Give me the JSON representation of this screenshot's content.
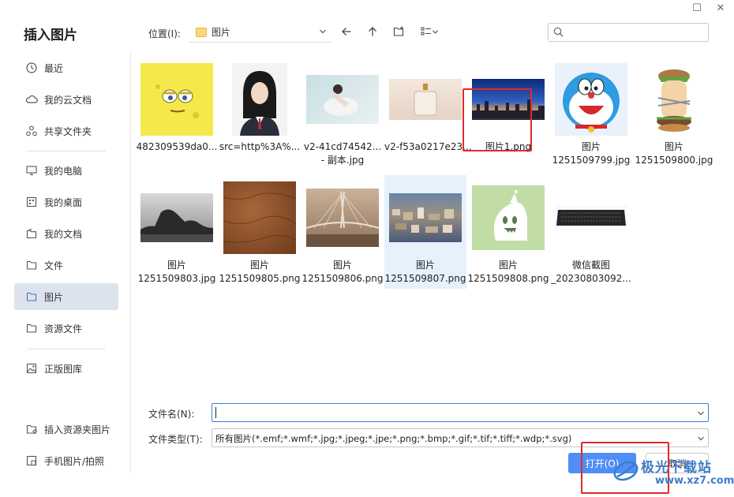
{
  "window": {
    "maximize_glyph": "☐",
    "close_glyph": "✕"
  },
  "title": "插入图片",
  "sidebar": {
    "items": [
      {
        "label": "最近",
        "icon": "clock-icon"
      },
      {
        "label": "我的云文档",
        "icon": "cloud-icon"
      },
      {
        "label": "共享文件夹",
        "icon": "share-icon"
      },
      {
        "label": "我的电脑",
        "icon": "monitor-icon"
      },
      {
        "label": "我的桌面",
        "icon": "desktop-icon"
      },
      {
        "label": "我的文档",
        "icon": "documents-icon"
      },
      {
        "label": "文件",
        "icon": "folder-icon"
      },
      {
        "label": "图片",
        "icon": "folder-icon",
        "active": true
      },
      {
        "label": "资源文件",
        "icon": "folder-icon"
      },
      {
        "label": "正版图库",
        "icon": "gallery-icon"
      },
      {
        "label": "插入资源夹图片",
        "icon": "star-folder-icon"
      },
      {
        "label": "手机图片/拍照",
        "icon": "phone-photo-icon"
      }
    ]
  },
  "toolbar": {
    "location_label": "位置(I):",
    "location_value": "图片",
    "search_placeholder": ""
  },
  "files": [
    {
      "name_l1": "482309539da0...",
      "name_l2": ""
    },
    {
      "name_l1": "src=http%3A%...",
      "name_l2": ""
    },
    {
      "name_l1": "v2-41cd74542...",
      "name_l2": "- 副本.jpg"
    },
    {
      "name_l1": "v2-f53a0217e23...",
      "name_l2": ""
    },
    {
      "name_l1": "图片1.png",
      "name_l2": ""
    },
    {
      "name_l1": "图片",
      "name_l2": "1251509799.jpg"
    },
    {
      "name_l1": "图片",
      "name_l2": "1251509800.jpg"
    },
    {
      "name_l1": "图片",
      "name_l2": "1251509803.jpg"
    },
    {
      "name_l1": "图片",
      "name_l2": "1251509805.png"
    },
    {
      "name_l1": "图片",
      "name_l2": "1251509806.png"
    },
    {
      "name_l1": "图片",
      "name_l2": "1251509807.png",
      "selected": true
    },
    {
      "name_l1": "图片",
      "name_l2": "1251509808.png"
    },
    {
      "name_l1": "微信截图",
      "name_l2": "_20230803092..."
    }
  ],
  "form": {
    "filename_label": "文件名(N):",
    "filename_value": "",
    "filetype_label": "文件类型(T):",
    "filetype_value": "所有图片(*.emf;*.wmf;*.jpg;*.jpeg;*.jpe;*.png;*.bmp;*.gif;*.tif;*.tiff;*.wdp;*.svg)"
  },
  "buttons": {
    "open": "打开(O)",
    "cancel": "取消"
  },
  "watermark": {
    "title": "极光下载站",
    "url": "www.xz7.com"
  },
  "colors": {
    "accent": "#4f8ef7",
    "highlight_box": "#e02a2a",
    "sidebar_active": "#dde3ee",
    "selected_tile": "#e5f1fb"
  }
}
